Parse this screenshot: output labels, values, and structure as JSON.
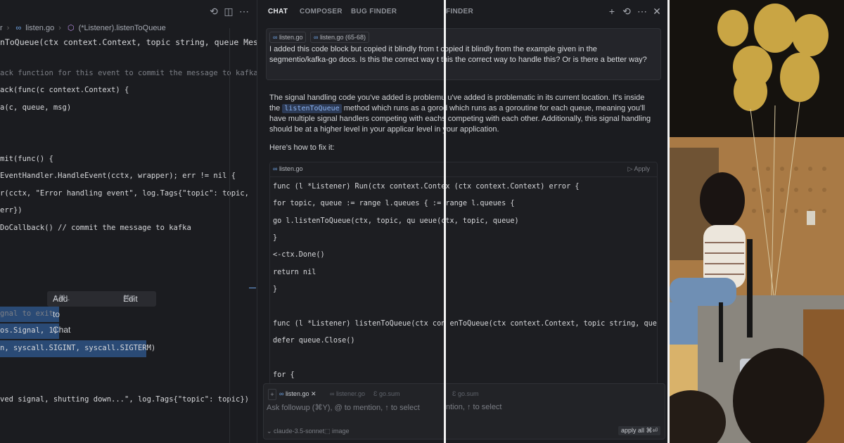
{
  "editor": {
    "breadcrumb": [
      "r",
      "listen.go",
      "(*Listener).listenToQueue"
    ],
    "signature": "nToQueue(ctx context.Context, topic string, queue MessageQueu",
    "lines": [
      {
        "text": "ack function for this event to commit the message to kafka",
        "cls": "cm"
      },
      {
        "text": "ack(func(c context.Context) {",
        "cls": ""
      },
      {
        "text": "a(c, queue, msg)",
        "cls": ""
      },
      {
        "text": "mit(func() {",
        "cls": ""
      },
      {
        "text": "EventHandler.HandleEvent(cctx, wrapper); err != nil {",
        "cls": ""
      },
      {
        "text": "r(cctx, \"Error handling event\", log.Tags{\"topic\": topic,",
        "cls": ""
      },
      {
        "text": " err})",
        "cls": ""
      },
      {
        "text": "DoCallback() // commit the message to kafka",
        "cls": ""
      },
      {
        "text": "gnal to exit",
        "cls": "cm"
      },
      {
        "text": " os.Signal, 1)",
        "cls": ""
      },
      {
        "text": "n, syscall.SIGINT, syscall.SIGTERM)",
        "cls": ""
      },
      {
        "text": "ved signal, shutting down...\", log.Tags{\"topic\": topic})",
        "cls": ""
      }
    ],
    "tooltip": {
      "add_label": "Add to Chat",
      "add_kbd": "⇧⌘L",
      "edit_label": "Edit",
      "edit_kbd": "⌘K"
    }
  },
  "chat": {
    "tabs": [
      "CHAT",
      "COMPOSER",
      "BUG FINDER",
      "FINDER"
    ],
    "user": {
      "pills": [
        "listen.go",
        "listen.go (65-68)"
      ],
      "message": "I added this code block but copied it blindly from t copied it blindly from the example given in the segmentio/kafka-go docs. Is this the correct way t this the correct way to handle this? Or is there a better way?"
    },
    "reply": {
      "p1_a": "The signal handling code you've added is problemu u've added is problematic in its current location. It's inside the ",
      "p1_code": "listenToQueue",
      "p1_b": " method which runs as a gorod which runs as a goroutine for each queue, meaning you'll have multiple signal handlers competing with eachs competing with each other. Additionally, this signal handling should be at a higher level in your applicar level in your application.",
      "p2": "Here's how to fix it:"
    },
    "codeblock": {
      "file": "listen.go",
      "apply": "Apply",
      "lines": [
        "func (l *Listener) Run(ctx context.Contex (ctx context.Context) error {",
        "    for topic, queue := range l.queues { := range l.queues {",
        "        go l.listenToQueue(ctx, topic, qu ueue(ctx, topic, queue)",
        "    }",
        "    <-ctx.Done()",
        "    return nil",
        "}",
        "",
        "func (l *Listener) listenToQueue(ctx con enToQueue(ctx context.Context, topic string, queue",
        "    defer queue.Close()",
        "",
        "    for {"
      ]
    },
    "input": {
      "context": [
        "listen.go",
        "listener.go",
        "go.sum",
        "go.sum"
      ],
      "placeholder": "Ask followup (⌘Y), @ to mention, ↑ to select",
      "placeholder_dup": "ntion, ↑ to select",
      "model": "claude-3.5-sonnet",
      "image_label": "image",
      "apply_all": "apply all ⌘⏎"
    }
  },
  "photo": {
    "description_colors": {
      "balloons": "#c9a544",
      "wall": "#a97a45",
      "shirt": "#ece6dc",
      "jeans": "#6f8fb4"
    }
  }
}
